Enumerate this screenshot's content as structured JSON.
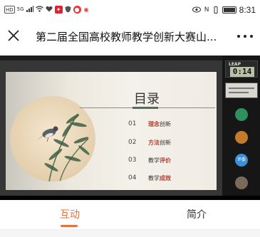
{
  "status_bar": {
    "left_icons": [
      "HD",
      "5G",
      "signal",
      "wifi",
      "heart",
      "red-app",
      "shield",
      "red-app-2",
      "weibo"
    ],
    "hd_label": "HD",
    "net_label": "5G",
    "time": "8:31"
  },
  "header": {
    "title": "第二届全国高校教师教学创新大赛山..."
  },
  "video": {
    "timer_brand": "LEAP",
    "timer_digits": "0:14",
    "slide": {
      "heading": "目录",
      "items": [
        {
          "num": "01",
          "prefix": "",
          "emphasis": "理念",
          "suffix": "创新"
        },
        {
          "num": "02",
          "prefix": "",
          "emphasis": "方法",
          "suffix": "创新"
        },
        {
          "num": "03",
          "prefix": "教学",
          "emphasis": "评价",
          "suffix": ""
        },
        {
          "num": "04",
          "prefix": "教学",
          "emphasis": "成效",
          "suffix": ""
        }
      ]
    },
    "participants": [
      {
        "label": "",
        "color": "#2f8f5f",
        "text": ""
      },
      {
        "label": "",
        "color": "#c47a2b",
        "text": ""
      },
      {
        "label": "",
        "color": "#3a8fd6",
        "text": "评委"
      },
      {
        "label": "",
        "color": "#7a6a5a",
        "text": ""
      }
    ]
  },
  "tabs": {
    "interact_label": "互动",
    "intro_label": "简介"
  },
  "colors": {
    "accent": "#e8703a",
    "emphasis_red": "#c0392b"
  }
}
